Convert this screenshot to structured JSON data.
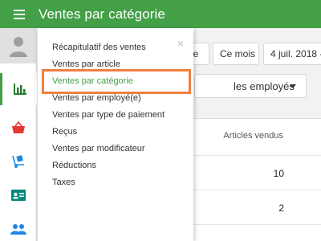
{
  "header": {
    "title": "Ventes par catégorie"
  },
  "datebar": {
    "chip_1": "ne",
    "chip_2": "Ce mois",
    "chip_3": "4 juil. 2018 -"
  },
  "employee_filter": {
    "label": "les employés"
  },
  "table": {
    "column_header": "Articles vendus",
    "rows": [
      {
        "value": "10"
      },
      {
        "value": "2"
      }
    ]
  },
  "menu": {
    "items": [
      {
        "label": "Récapitulatif des ventes"
      },
      {
        "label": "Ventes par article"
      },
      {
        "label": "Ventes par catégorie"
      },
      {
        "label": "Ventes par employé(e)"
      },
      {
        "label": "Ventes par type de paiement"
      },
      {
        "label": "Reçus"
      },
      {
        "label": "Ventes par modificateur"
      },
      {
        "label": "Réductions"
      },
      {
        "label": "Taxes"
      }
    ],
    "close_glyph": "×"
  },
  "colors": {
    "brand_green": "#43a047",
    "highlight_orange": "#f0803c",
    "icon_red": "#e53935",
    "icon_teal": "#00897b",
    "icon_blue": "#1e88e5",
    "icon_darkgreen": "#2e7d32"
  },
  "icons": [
    "menu-icon",
    "avatar-icon",
    "bar-chart-icon",
    "basket-icon",
    "handtruck-icon",
    "id-card-icon",
    "people-icon"
  ]
}
